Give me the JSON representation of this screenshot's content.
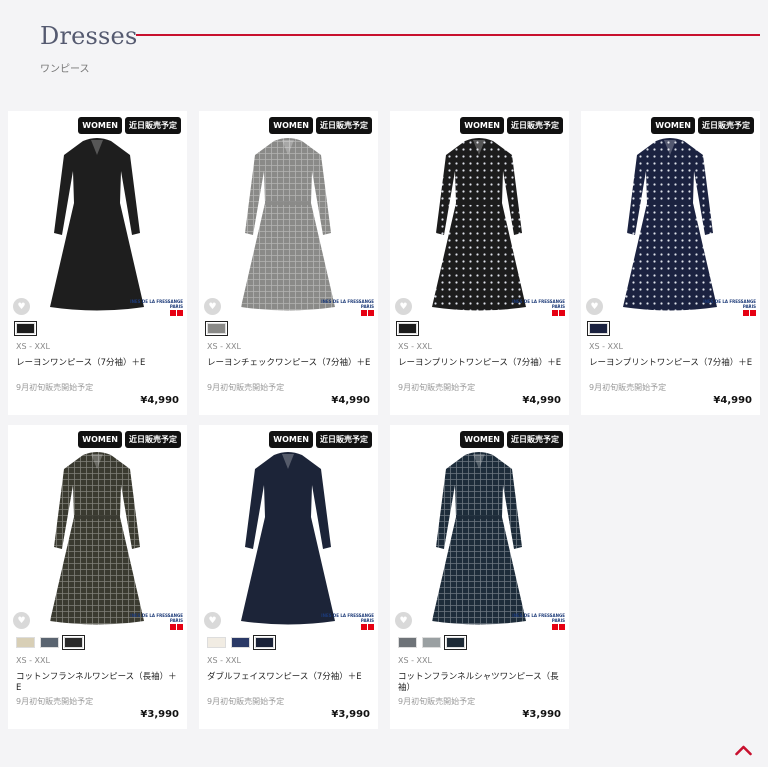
{
  "header": {
    "title": "Dresses",
    "subtitle": "ワンピース"
  },
  "tags": {
    "women": "WOMEN",
    "coming": "近日販売予定"
  },
  "brand": {
    "line1": "INES DE LA FRESSANGE",
    "line2": "PARIS"
  },
  "products": [
    {
      "size": "XS - XXL",
      "name": "レーヨンワンピース（7分袖）＋E",
      "note": "9月初旬販売開始予定",
      "price": "¥4,990",
      "swatches": [
        "#1d1d1d"
      ],
      "selected": 0,
      "color": "#1e1e1e",
      "pattern": "solid"
    },
    {
      "size": "XS - XXL",
      "name": "レーヨンチェックワンピース（7分袖）＋E",
      "note": "9月初旬販売開始予定",
      "price": "¥4,990",
      "swatches": [
        "#8a8a88"
      ],
      "selected": 0,
      "color": "#8a8a88",
      "pattern": "check"
    },
    {
      "size": "XS - XXL",
      "name": "レーヨンプリントワンピース（7分袖）＋E",
      "note": "9月初旬販売開始予定",
      "price": "¥4,990",
      "swatches": [
        "#1c1c1c"
      ],
      "selected": 0,
      "color": "#1c1c1c",
      "pattern": "dots"
    },
    {
      "size": "XS - XXL",
      "name": "レーヨンプリントワンピース（7分袖）＋E",
      "note": "9月初旬販売開始予定",
      "price": "¥4,990",
      "swatches": [
        "#1b2240"
      ],
      "selected": 0,
      "color": "#1b2240",
      "pattern": "dots"
    },
    {
      "size": "XS - XXL",
      "name": "コットンフランネルワンピース（長袖）＋E",
      "note": "9月初旬販売開始予定",
      "price": "¥3,990",
      "swatches": [
        "#d8cfb6",
        "#5a6470",
        "#2a2a2a"
      ],
      "selected": 2,
      "color": "#3a3a30",
      "pattern": "check"
    },
    {
      "size": "XS - XXL",
      "name": "ダブルフェイスワンピース（7分袖）＋E",
      "note": "9月初旬販売開始予定",
      "price": "¥3,990",
      "swatches": [
        "#f1ece3",
        "#2a3966",
        "#1a2238"
      ],
      "selected": 2,
      "color": "#1c2438",
      "pattern": "solid"
    },
    {
      "size": "XS - XXL",
      "name": "コットンフランネルシャツワンピース（長袖）",
      "note": "9月初旬販売開始予定",
      "price": "¥3,990",
      "swatches": [
        "#6e7378",
        "#9aa0a2",
        "#1d2a36"
      ],
      "selected": 2,
      "color": "#1d2c3a",
      "pattern": "check"
    }
  ]
}
